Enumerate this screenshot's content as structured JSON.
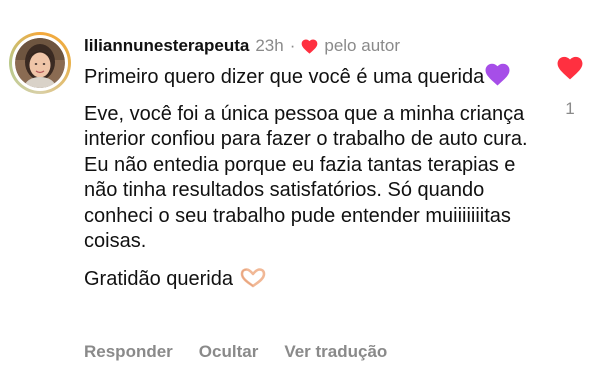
{
  "comment": {
    "username": "liliannunesterapeuta",
    "time": "23h",
    "separator": "·",
    "liked_by_label": "pelo autor",
    "paragraphs": [
      "Primeiro quero dizer que você é uma querida",
      "Eve, você foi a única pessoa que a minha criança interior confiou para fazer o trabalho de auto cura. Eu não entedia porque eu fazia tantas terapias e não tinha resultados satisfatórios. Só quando conheci o seu trabalho pude entender muiiiiiiitas coisas.",
      "Gratidão querida"
    ],
    "like_count": "1"
  },
  "actions": {
    "reply_label": "Responder",
    "hide_label": "Ocultar",
    "translate_label": "Ver tradução"
  },
  "colors": {
    "heart_red": "#ff3040",
    "muted_text": "#8a8a8a",
    "purple_heart": "#a64ee8"
  },
  "icons": {
    "author_like": "heart-icon",
    "like_button": "heart-icon",
    "emoji_1": "purple-heart-icon",
    "emoji_2": "hand-heart-icon"
  }
}
